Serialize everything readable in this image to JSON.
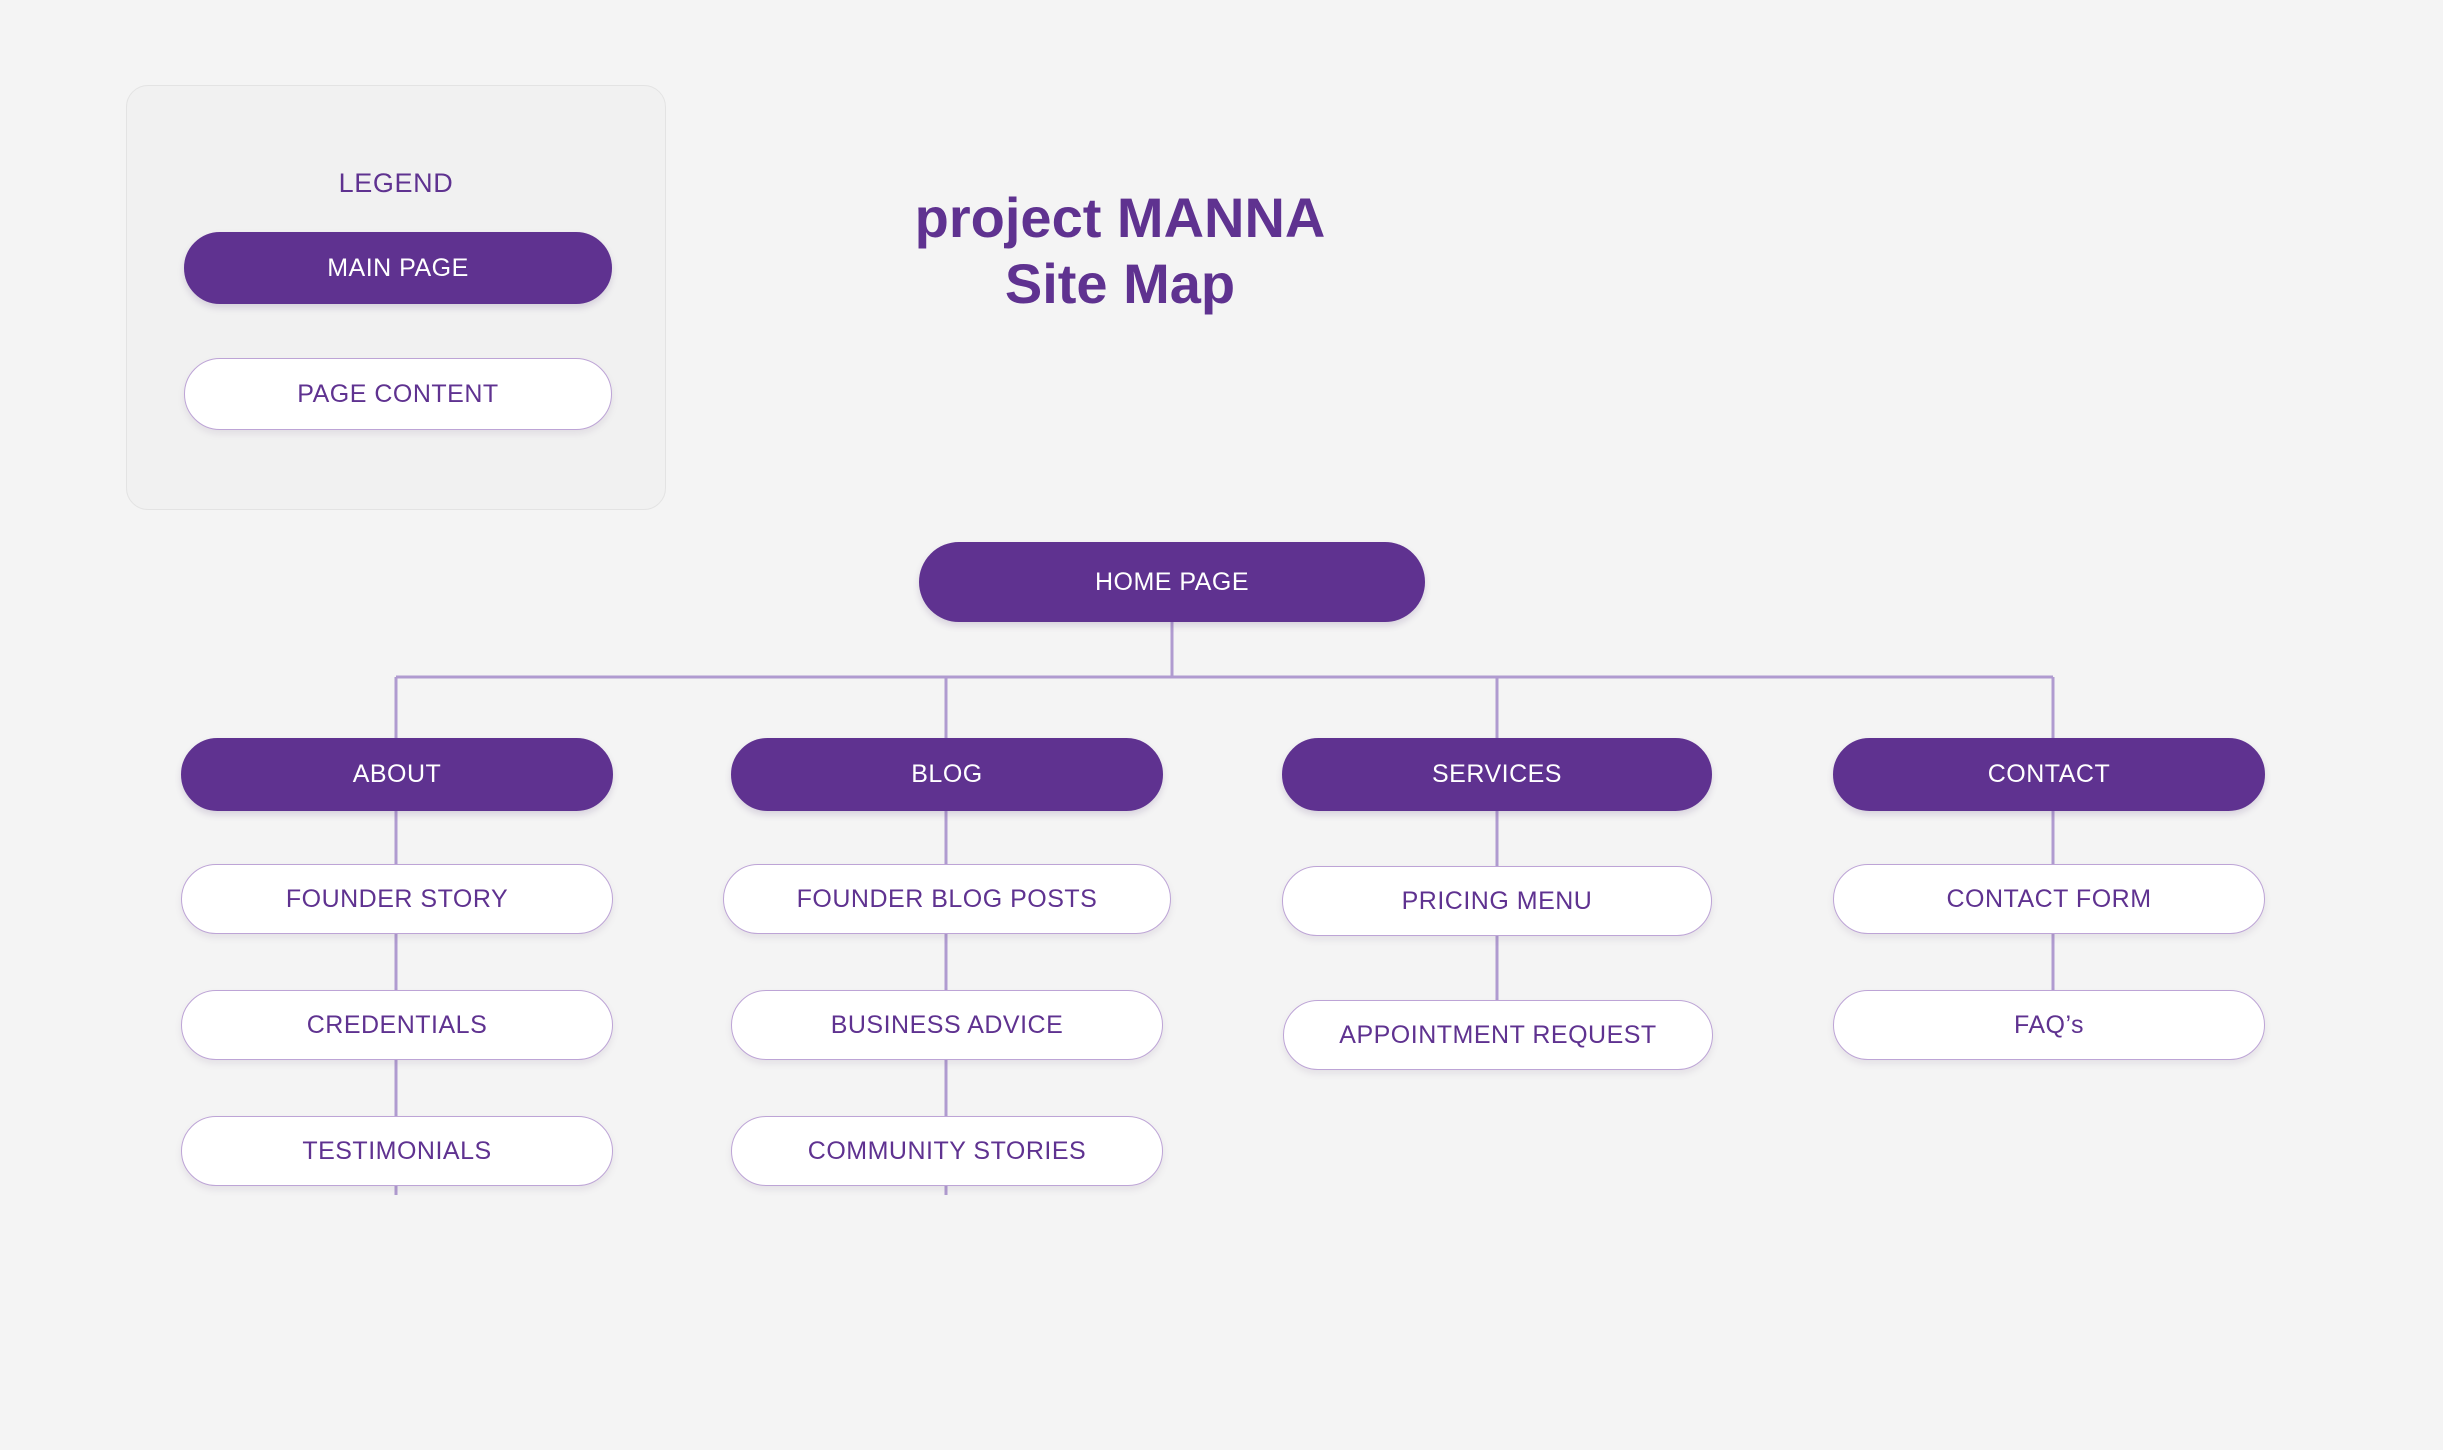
{
  "page": {
    "background_color": "#f4f4f4",
    "accent_color": "#5f3290",
    "connector_color": "#b09bd0",
    "content_border_color": "#bda4d6"
  },
  "title": {
    "line1": "project MANNA",
    "line2": "Site Map"
  },
  "legend": {
    "heading": "LEGEND",
    "items": [
      {
        "label": "MAIN PAGE",
        "type": "main"
      },
      {
        "label": "PAGE CONTENT",
        "type": "content"
      }
    ]
  },
  "sitemap": {
    "root": {
      "label": "HOME PAGE",
      "type": "main"
    },
    "branches": [
      {
        "label": "ABOUT",
        "type": "main",
        "children": [
          {
            "label": "FOUNDER STORY",
            "type": "content"
          },
          {
            "label": "CREDENTIALS",
            "type": "content"
          },
          {
            "label": "TESTIMONIALS",
            "type": "content"
          }
        ]
      },
      {
        "label": "BLOG",
        "type": "main",
        "children": [
          {
            "label": "FOUNDER BLOG POSTS",
            "type": "content"
          },
          {
            "label": "BUSINESS ADVICE",
            "type": "content"
          },
          {
            "label": "COMMUNITY STORIES",
            "type": "content"
          }
        ]
      },
      {
        "label": "SERVICES",
        "type": "main",
        "children": [
          {
            "label": "PRICING MENU",
            "type": "content"
          },
          {
            "label": "APPOINTMENT REQUEST",
            "type": "content"
          }
        ]
      },
      {
        "label": "CONTACT",
        "type": "main",
        "children": [
          {
            "label": "CONTACT FORM",
            "type": "content"
          },
          {
            "label": "FAQ’s",
            "type": "content"
          }
        ]
      }
    ]
  }
}
